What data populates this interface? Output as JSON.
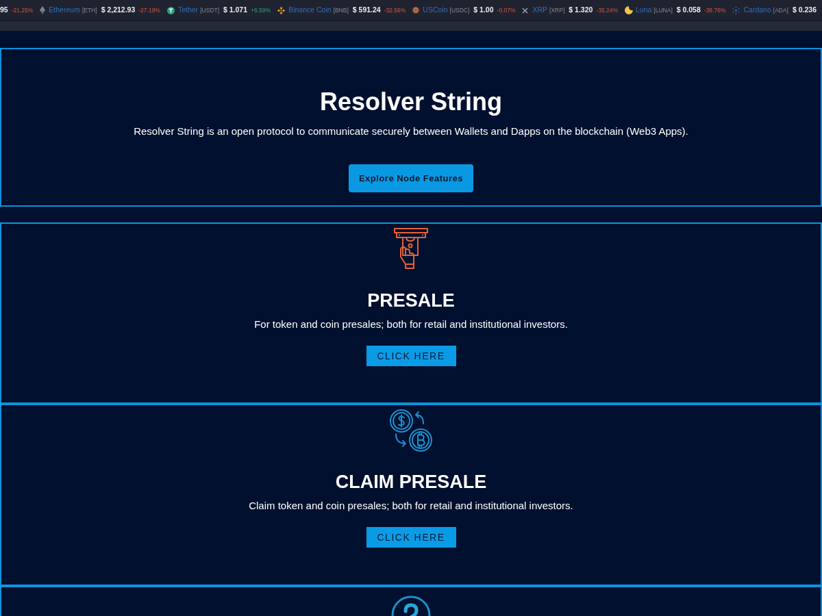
{
  "ticker": {
    "items": [
      {
        "price": "95",
        "change": "-21.25%",
        "rising": false
      },
      {
        "name": "Ethereum",
        "symbol": "[ETH]",
        "price": "$ 2,212.93",
        "change": "-27.19%",
        "rising": false
      },
      {
        "name": "Tether",
        "symbol": "[USDT]",
        "price": "$ 1.071",
        "change": "+6.59%",
        "rising": true
      },
      {
        "name": "Binance Coin",
        "symbol": "[BNB]",
        "price": "$ 591.24",
        "change": "-32.56%",
        "rising": false
      },
      {
        "name": "USCoin",
        "symbol": "[USDC]",
        "price": "$ 1.00",
        "change": "-0.07%",
        "rising": false
      },
      {
        "name": "XRP",
        "symbol": "[XRP]",
        "price": "$ 1.320",
        "change": "-35.24%",
        "rising": false
      },
      {
        "name": "Luna",
        "symbol": "[LUNA]",
        "price": "$ 0.058",
        "change": "-38.76%",
        "rising": false
      },
      {
        "name": "Cardano",
        "symbol": "[ADA]",
        "price": "$ 0.236"
      }
    ]
  },
  "hero": {
    "title": "Resolver String",
    "subtitle": "Resolver String is an open protocol to communicate securely between Wallets and Dapps on the blockchain (Web3 Apps).",
    "button": "Explore Node Features"
  },
  "sections": [
    {
      "title": "PRESALE",
      "description": "For token and coin presales; both for retail and institutional investors.",
      "button": "CLICK HERE"
    },
    {
      "title": "CLAIM PRESALE",
      "description": "Claim token and coin presales; both for retail and institutional investors.",
      "button": "CLICK HERE"
    }
  ]
}
